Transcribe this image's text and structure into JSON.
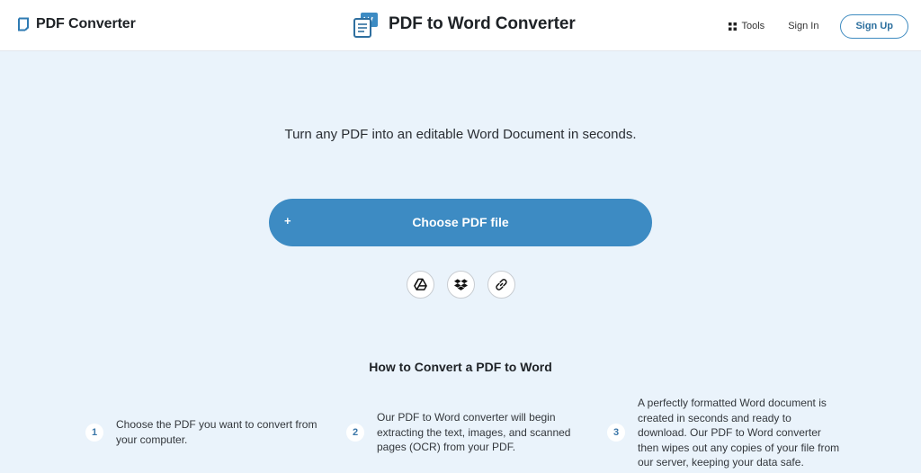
{
  "header": {
    "logo_text": "PDF Converter",
    "logo_icon": "document-outline-icon",
    "page_title": "PDF to Word Converter",
    "title_icon": "pdf-to-word-icon",
    "nav": {
      "tools_label": "Tools",
      "tools_icon": "grid-icon",
      "signin_label": "Sign In",
      "signup_label": "Sign Up"
    }
  },
  "main": {
    "tagline": "Turn any PDF into an editable Word Document in seconds.",
    "choose_button": {
      "plus": "+",
      "label": "Choose PDF file"
    },
    "sources": [
      {
        "icon": "google-drive-icon"
      },
      {
        "icon": "dropbox-icon"
      },
      {
        "icon": "link-icon"
      }
    ]
  },
  "howto": {
    "title": "How to Convert a PDF to Word",
    "steps": [
      {
        "num": "1",
        "text": "Choose the PDF you want to convert from your computer."
      },
      {
        "num": "2",
        "text": "Our PDF to Word converter will begin extracting the text, images, and scanned pages (OCR) from your PDF."
      },
      {
        "num": "3",
        "text": "A perfectly formatted Word document is created in seconds and ready to download. Our PDF to Word converter then wipes out any copies of your file from our server, keeping your data safe."
      }
    ]
  },
  "colors": {
    "accent": "#3d8bc3",
    "background": "#eaf3fb",
    "header_bg": "#ffffff",
    "text": "#1e2226"
  }
}
